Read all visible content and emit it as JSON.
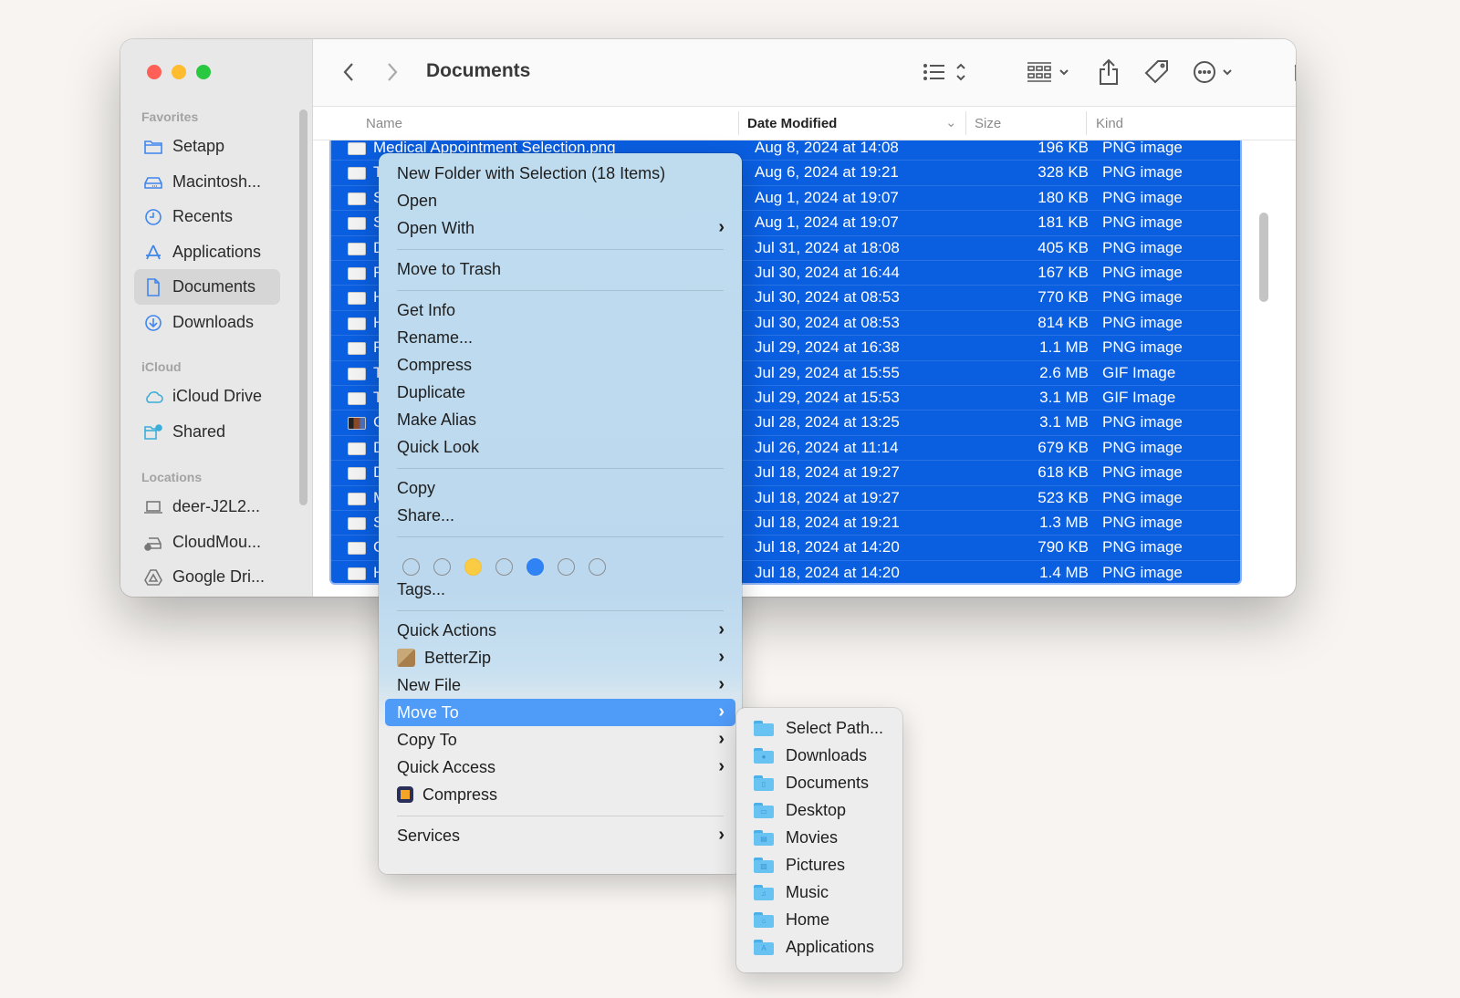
{
  "window": {
    "title": "Documents",
    "colors": {
      "selection": "#0a5ee0",
      "highlight": "#4f9bf8",
      "close": "#fe5f57",
      "minimize": "#febc2e",
      "maximize": "#28c840"
    }
  },
  "sidebar": {
    "sections": [
      {
        "label": "Favorites",
        "items": [
          {
            "label": "Setapp",
            "icon": "folder-icon"
          },
          {
            "label": "Macintosh...",
            "icon": "hard-drive-icon"
          },
          {
            "label": "Recents",
            "icon": "clock-icon"
          },
          {
            "label": "Applications",
            "icon": "applications-icon"
          },
          {
            "label": "Documents",
            "icon": "document-icon",
            "active": true
          },
          {
            "label": "Downloads",
            "icon": "download-icon"
          }
        ]
      },
      {
        "label": "iCloud",
        "items": [
          {
            "label": "iCloud Drive",
            "icon": "cloud-icon"
          },
          {
            "label": "Shared",
            "icon": "shared-folder-icon"
          }
        ]
      },
      {
        "label": "Locations",
        "items": [
          {
            "label": "deer-J2L2...",
            "icon": "laptop-icon"
          },
          {
            "label": "CloudMou...",
            "icon": "cloud-drive-icon"
          },
          {
            "label": "Google Dri...",
            "icon": "google-drive-icon"
          }
        ]
      }
    ]
  },
  "toolbar": {
    "back": "back-icon",
    "forward": "forward-icon",
    "view_list": "list-view-icon",
    "group": "group-icon",
    "share": "share-icon",
    "tag": "tag-icon",
    "more": "more-icon",
    "drive": "drive-icon",
    "search": "search-icon"
  },
  "columns": {
    "name": "Name",
    "date": "Date Modified",
    "size": "Size",
    "kind": "Kind"
  },
  "files": [
    {
      "name": "Medical Appointment Selection.png",
      "date": "Aug 8, 2024 at 14:08",
      "size": "196 KB",
      "kind": "PNG image"
    },
    {
      "name": "T",
      "date": "Aug 6, 2024 at 19:21",
      "size": "328 KB",
      "kind": "PNG image"
    },
    {
      "name": "S",
      "date": "Aug 1, 2024 at 19:07",
      "size": "180 KB",
      "kind": "PNG image"
    },
    {
      "name": "S",
      "date": "Aug 1, 2024 at 19:07",
      "size": "181 KB",
      "kind": "PNG image"
    },
    {
      "name": "D",
      "date": "Jul 31, 2024 at 18:08",
      "size": "405 KB",
      "kind": "PNG image"
    },
    {
      "name": "F",
      "date": "Jul 30, 2024 at 16:44",
      "size": "167 KB",
      "kind": "PNG image"
    },
    {
      "name": "H",
      "date": "Jul 30, 2024 at 08:53",
      "size": "770 KB",
      "kind": "PNG image"
    },
    {
      "name": "H",
      "date": "Jul 30, 2024 at 08:53",
      "size": "814 KB",
      "kind": "PNG image"
    },
    {
      "name": "F",
      "date": "Jul 29, 2024 at 16:38",
      "size": "1.1 MB",
      "kind": "PNG image"
    },
    {
      "name": "T",
      "date": "Jul 29, 2024 at 15:55",
      "size": "2.6 MB",
      "kind": "GIF Image"
    },
    {
      "name": "T",
      "date": "Jul 29, 2024 at 15:53",
      "size": "3.1 MB",
      "kind": "GIF Image"
    },
    {
      "name": "C",
      "date": "Jul 28, 2024 at 13:25",
      "size": "3.1 MB",
      "kind": "PNG image",
      "dark": true
    },
    {
      "name": "D",
      "date": "Jul 26, 2024 at 11:14",
      "size": "679 KB",
      "kind": "PNG image"
    },
    {
      "name": "D",
      "date": "Jul 18, 2024 at 19:27",
      "size": "618 KB",
      "kind": "PNG image"
    },
    {
      "name": "M",
      "date": "Jul 18, 2024 at 19:27",
      "size": "523 KB",
      "kind": "PNG image"
    },
    {
      "name": "S",
      "date": "Jul 18, 2024 at 19:21",
      "size": "1.3 MB",
      "kind": "PNG image"
    },
    {
      "name": "C",
      "date": "Jul 18, 2024 at 14:20",
      "size": "790 KB",
      "kind": "PNG image"
    },
    {
      "name": "H",
      "date": "Jul 18, 2024 at 14:20",
      "size": "1.4 MB",
      "kind": "PNG image"
    }
  ],
  "context_menu": {
    "items": [
      {
        "label": "New Folder with Selection (18 Items)"
      },
      {
        "label": "Open"
      },
      {
        "label": "Open With",
        "submenu": true
      },
      {
        "label": "Move to Trash"
      },
      {
        "label": "Get Info"
      },
      {
        "label": "Rename..."
      },
      {
        "label": "Compress"
      },
      {
        "label": "Duplicate"
      },
      {
        "label": "Make Alias"
      },
      {
        "label": "Quick Look"
      },
      {
        "label": "Copy"
      },
      {
        "label": "Share..."
      },
      {
        "label": "Tags..."
      },
      {
        "label": "Quick Actions",
        "submenu": true
      },
      {
        "label": "BetterZip",
        "submenu": true,
        "icon": "betterzip-icon"
      },
      {
        "label": "New File",
        "submenu": true
      },
      {
        "label": "Move To",
        "submenu": true,
        "highlighted": true
      },
      {
        "label": "Copy To",
        "submenu": true
      },
      {
        "label": "Quick Access",
        "submenu": true
      },
      {
        "label": "Compress",
        "icon": "compress-app-icon"
      },
      {
        "label": "Services",
        "submenu": true
      }
    ],
    "tags": [
      {
        "color": "none"
      },
      {
        "color": "none"
      },
      {
        "color": "yellow",
        "hex": "#f9cc44"
      },
      {
        "color": "none"
      },
      {
        "color": "blue",
        "hex": "#2f83f5"
      },
      {
        "color": "none"
      },
      {
        "color": "none"
      }
    ],
    "chevron": "›"
  },
  "move_to_submenu": {
    "items": [
      {
        "label": "Select Path...",
        "glyph": ""
      },
      {
        "label": "Downloads",
        "glyph": "●"
      },
      {
        "label": "Documents",
        "glyph": "▯"
      },
      {
        "label": "Desktop",
        "glyph": "▭"
      },
      {
        "label": "Movies",
        "glyph": "▤"
      },
      {
        "label": "Pictures",
        "glyph": "▨"
      },
      {
        "label": "Music",
        "glyph": "♫"
      },
      {
        "label": "Home",
        "glyph": "⌂"
      },
      {
        "label": "Applications",
        "glyph": "A"
      }
    ]
  }
}
